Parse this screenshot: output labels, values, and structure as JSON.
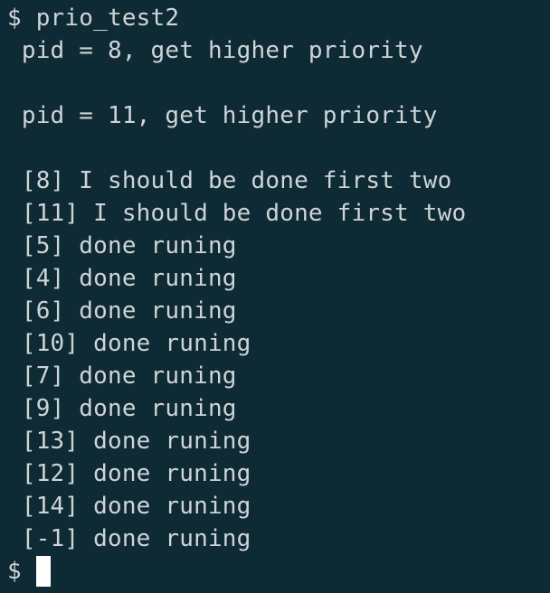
{
  "terminal": {
    "lines": [
      "$ prio_test2",
      " pid = 8, get higher priority",
      "",
      " pid = 11, get higher priority",
      "",
      " [8] I should be done first two",
      " [11] I should be done first two",
      " [5] done runing",
      " [4] done runing",
      " [6] done runing",
      " [10] done runing",
      " [7] done runing",
      " [9] done runing",
      " [13] done runing",
      " [12] done runing",
      " [14] done runing",
      " [-1] done runing"
    ],
    "prompt": "$"
  }
}
